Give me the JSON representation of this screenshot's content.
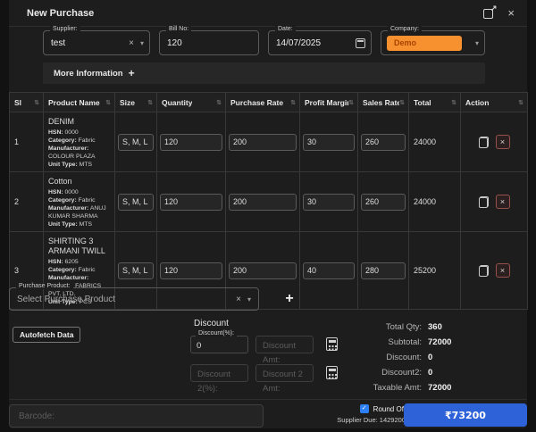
{
  "dialog": {
    "title": "New Purchase"
  },
  "icons": {
    "close": "×",
    "clear": "×",
    "caret": "▾",
    "sort": "⇅",
    "check": "✓",
    "plus": "+"
  },
  "form": {
    "supplier": {
      "label": "Supplier:",
      "value": "test"
    },
    "bill_no": {
      "label": "Bill No:",
      "value": "120"
    },
    "date": {
      "label": "Date:",
      "value": "14/07/2025"
    },
    "company": {
      "label": "Company:",
      "value": "Demo",
      "accent": "#f7902e"
    },
    "more_information": "More Information"
  },
  "table": {
    "columns": [
      "Sl",
      "Product Name",
      "Size",
      "Quantity",
      "Purchase Rate",
      "Profit Margin",
      "Sales Rate",
      "Total",
      "Action"
    ],
    "detail_labels": {
      "hsn": "HSN:",
      "category": "Category:",
      "manufacturer": "Manufacturer:",
      "unit_type": "Unit Type:"
    },
    "rows": [
      {
        "sl": "1",
        "name": "DENIM",
        "hsn": "0000",
        "category": "Fabric",
        "manufacturer": "COLOUR PLAZA",
        "unit_type": "MTS",
        "size": "S, M, L",
        "quantity": "120",
        "purchase_rate": "200",
        "profit_margin": "30",
        "sales_rate": "260",
        "total": "24000"
      },
      {
        "sl": "2",
        "name": "Cotton",
        "hsn": "0000",
        "category": "Fabric",
        "manufacturer": "ANUJ KUMAR SHARMA",
        "unit_type": "MTS",
        "size": "S, M, L",
        "quantity": "120",
        "purchase_rate": "200",
        "profit_margin": "30",
        "sales_rate": "260",
        "total": "24000"
      },
      {
        "sl": "3",
        "name": "SHIRTING 3 ARMANI TWILL",
        "hsn": "6205",
        "category": "Fabric",
        "manufacturer": "SAMEEP FABRICS PVT. LTD.",
        "unit_type": "PCS",
        "size": "S, M, L",
        "quantity": "120",
        "purchase_rate": "200",
        "profit_margin": "40",
        "sales_rate": "280",
        "total": "25200"
      }
    ]
  },
  "purchase_product": {
    "label": "Purchase Product:",
    "placeholder": "Select Purchase Product"
  },
  "buttons": {
    "autofetch": "Autofetch Data"
  },
  "discount": {
    "heading": "Discount",
    "pct_label": "Discount(%):",
    "pct_value": "0",
    "amt_placeholder": "Discount Amt:",
    "pct2_placeholder": "Discount 2(%):",
    "amt2_placeholder": "Discount 2 Amt:"
  },
  "totals": [
    {
      "label": "Total Qty:",
      "value": "360"
    },
    {
      "label": "Subtotal:",
      "value": "72000"
    },
    {
      "label": "Discount:",
      "value": "0"
    },
    {
      "label": "Discount2:",
      "value": "0"
    },
    {
      "label": "Taxable Amt:",
      "value": "72000"
    }
  ],
  "footer": {
    "barcode_placeholder": "Barcode:",
    "round_off_label": "Round Off",
    "supplier_due": "Supplier Due: 1429200",
    "total_button": "₹73200",
    "button_color": "#2e62d9"
  }
}
